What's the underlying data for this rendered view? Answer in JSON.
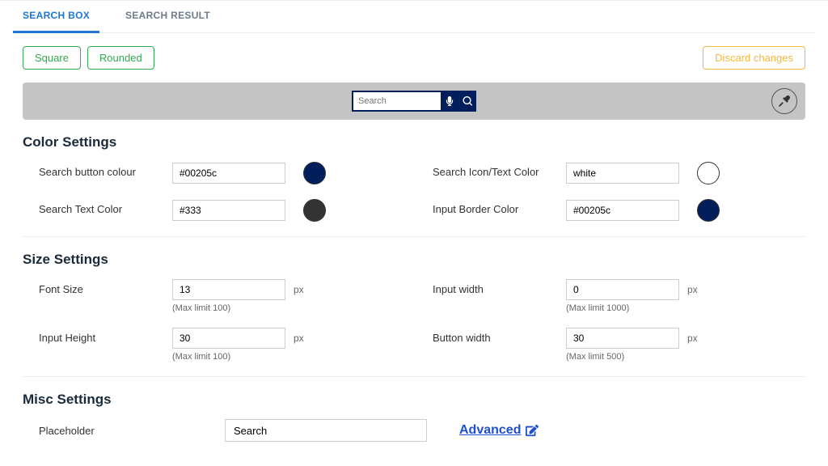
{
  "tabs": {
    "searchBox": "SEARCH BOX",
    "searchResult": "SEARCH RESULT"
  },
  "buttons": {
    "square": "Square",
    "rounded": "Rounded",
    "discard": "Discard changes"
  },
  "preview": {
    "placeholder": "Search"
  },
  "sections": {
    "color": "Color Settings",
    "size": "Size Settings",
    "misc": "Misc Settings"
  },
  "color": {
    "searchButtonColour": {
      "label": "Search button colour",
      "value": "#00205c",
      "swatch": "#031f5b"
    },
    "searchIconTextColor": {
      "label": "Search Icon/Text Color",
      "value": "white",
      "swatch": "#ffffff"
    },
    "searchTextColor": {
      "label": "Search Text Color",
      "value": "#333",
      "swatch": "#333333"
    },
    "inputBorderColor": {
      "label": "Input Border Color",
      "value": "#00205c",
      "swatch": "#031f5b"
    }
  },
  "size": {
    "fontSize": {
      "label": "Font Size",
      "value": "13",
      "unit": "px",
      "hint": "(Max limit 100)"
    },
    "inputWidth": {
      "label": "Input width",
      "value": "0",
      "unit": "px",
      "hint": "(Max limit 1000)"
    },
    "inputHeight": {
      "label": "Input Height",
      "value": "30",
      "unit": "px",
      "hint": "(Max limit 100)"
    },
    "buttonWidth": {
      "label": "Button width",
      "value": "30",
      "unit": "px",
      "hint": "(Max limit 500)"
    }
  },
  "misc": {
    "placeholderLabel": "Placeholder",
    "placeholderValue": "Search",
    "advanced": "Advanced"
  }
}
